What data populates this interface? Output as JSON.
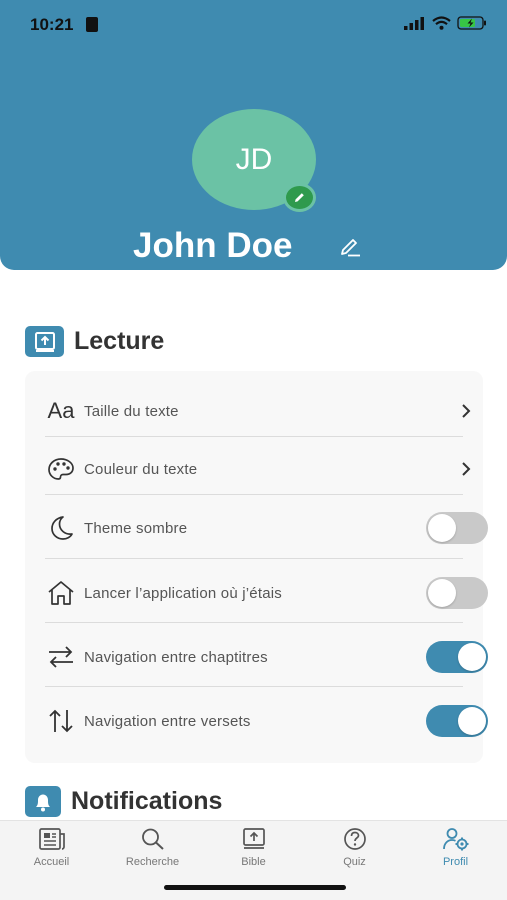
{
  "status_bar": {
    "time": "10:21"
  },
  "profile": {
    "initials": "JD",
    "name": "John Doe"
  },
  "sections": {
    "lecture": {
      "title": "Lecture",
      "items": [
        {
          "label": "Taille du texte",
          "icon": "text-size-icon",
          "control": "chevron"
        },
        {
          "label": "Couleur du texte",
          "icon": "palette-icon",
          "control": "chevron"
        },
        {
          "label": "Theme sombre",
          "icon": "moon-icon",
          "control": "toggle",
          "on": false
        },
        {
          "label": "Lancer l’application où j’étais",
          "icon": "house-icon",
          "control": "toggle",
          "on": false
        },
        {
          "label": "Navigation entre chaptitres",
          "icon": "swap-horizontal-icon",
          "control": "toggle",
          "on": true
        },
        {
          "label": "Navigation entre versets",
          "icon": "swap-vertical-icon",
          "control": "toggle",
          "on": true
        }
      ]
    },
    "notifications": {
      "title": "Notifications"
    }
  },
  "tabs": [
    {
      "label": "Accueil",
      "icon": "newspaper-icon",
      "active": false
    },
    {
      "label": "Recherche",
      "icon": "search-icon",
      "active": false
    },
    {
      "label": "Bible",
      "icon": "book-icon",
      "active": false
    },
    {
      "label": "Quiz",
      "icon": "question-icon",
      "active": false
    },
    {
      "label": "Profil",
      "icon": "profile-gear-icon",
      "active": true
    }
  ],
  "colors": {
    "accent": "#3f8bb0",
    "avatar": "#6bc2a5",
    "edit_badge": "#2f9a4d"
  }
}
